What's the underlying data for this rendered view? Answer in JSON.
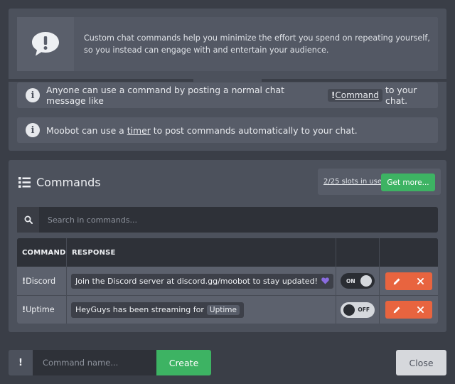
{
  "intro": {
    "description": "Custom chat commands help you minimize the effort you spend on repeating yourself, so you instead can engage with and entertain your audience.",
    "icon": "speech-bubble-exclamation-icon",
    "info_icon": "info-icon",
    "info_1": {
      "before": "Anyone can use a command by posting a normal chat message like",
      "code_prefix": "!",
      "code_text": "Command",
      "after": "to your chat."
    },
    "info_2": {
      "before": "Moobot can use a",
      "link": "timer",
      "after": "to post commands automatically to your chat."
    }
  },
  "commands": {
    "title": "Commands",
    "title_icon": "list-icon",
    "slots_text": "2/25 slots in use",
    "get_more_label": "Get more...",
    "search_icon": "search-icon",
    "search_placeholder": "Search in commands...",
    "columns": [
      "COMMAND",
      "RESPONSE",
      "",
      ""
    ],
    "rows": [
      {
        "prefix": "!",
        "name": "Discord",
        "response": "Join the Discord server at discord.gg/moobot to stay updated!",
        "response_icon": "purple-heart-icon",
        "enabled": true,
        "toggle_label": "ON",
        "actions": [
          "edit-icon",
          "delete-icon"
        ]
      },
      {
        "prefix": "!",
        "name": "Uptime",
        "response": "HeyGuys has been streaming for",
        "variable": "Uptime",
        "enabled": false,
        "toggle_label": "OFF",
        "actions": [
          "edit-icon",
          "delete-icon"
        ]
      }
    ]
  },
  "footer": {
    "prefix": "!",
    "input_placeholder": "Command name...",
    "create_label": "Create",
    "close_label": "Close"
  },
  "colors": {
    "background": "#3a3e47",
    "panel": "#4c515c",
    "accent_green": "#3db363",
    "action_orange": "#e8643f",
    "heart_purple": "#8a6ce0"
  }
}
